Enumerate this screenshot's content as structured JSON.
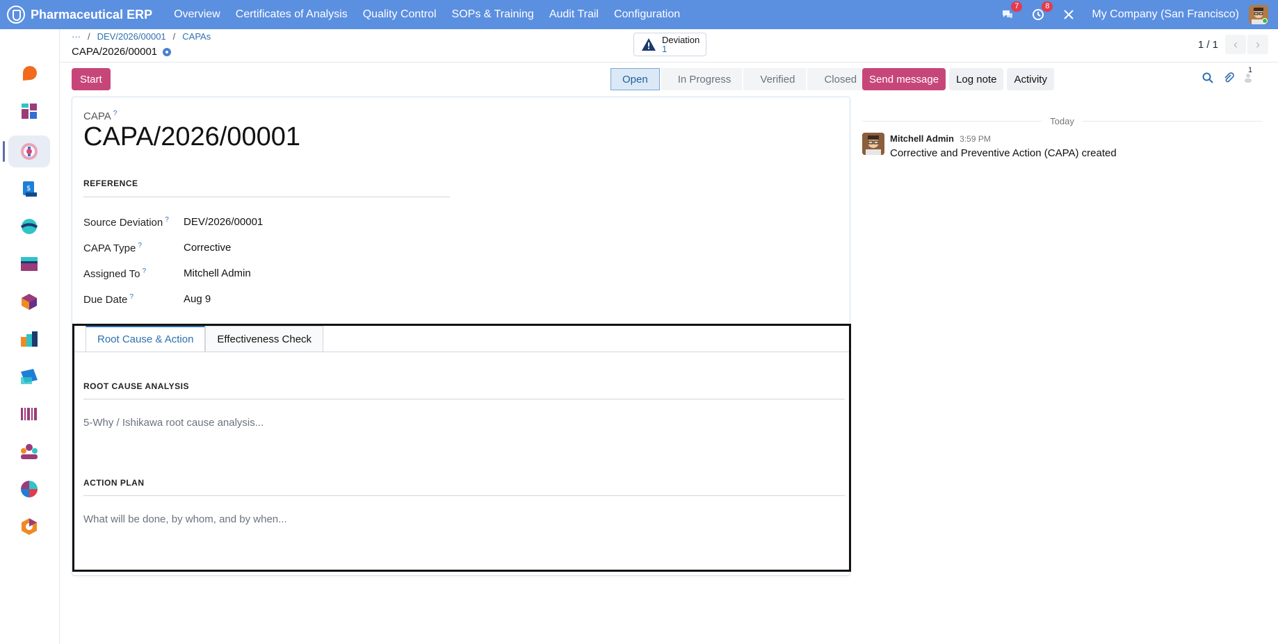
{
  "app": {
    "title": "Pharmaceutical ERP"
  },
  "nav": {
    "items": [
      "Overview",
      "Certificates of Analysis",
      "Quality Control",
      "SOPs & Training",
      "Audit Trail",
      "Configuration"
    ]
  },
  "topbar": {
    "messages_count": "7",
    "activities_count": "8",
    "company": "My Company (San Francisco)"
  },
  "sidebar": {
    "apps": [
      "discuss-icon",
      "dashboard-icon",
      "quality-icon",
      "invoicing-icon",
      "website-icon",
      "accounting-icon",
      "inventory-icon",
      "manufacturing-icon",
      "purchase-icon",
      "barcode-icon",
      "employees-icon",
      "reports-icon",
      "settings-icon"
    ]
  },
  "breadcrumb": {
    "ellipsis": "···",
    "parent": "DEV/2026/00001",
    "list": "CAPAs",
    "current": "CAPA/2026/00001"
  },
  "smart_button": {
    "label": "Deviation",
    "count": "1"
  },
  "pager": {
    "value": "1 / 1",
    "prev": "‹",
    "next": "›"
  },
  "actions": {
    "start": "Start"
  },
  "statusbar": {
    "stages": [
      "Open",
      "In Progress",
      "Verified",
      "Closed"
    ],
    "current": "Open"
  },
  "form": {
    "record_label": "CAPA",
    "record_name": "CAPA/2026/00001",
    "reference_heading": "REFERENCE",
    "fields": [
      {
        "label": "Source Deviation",
        "value": "DEV/2026/00001"
      },
      {
        "label": "CAPA Type",
        "value": "Corrective"
      },
      {
        "label": "Assigned To",
        "value": "Mitchell Admin"
      },
      {
        "label": "Due Date",
        "value": "Aug 9"
      }
    ],
    "help_mark": "?"
  },
  "tabs": {
    "items": [
      "Root Cause & Action",
      "Effectiveness Check"
    ],
    "active": "Root Cause & Action",
    "rca_heading": "ROOT CAUSE ANALYSIS",
    "rca_placeholder": "5-Why / Ishikawa root cause analysis...",
    "action_heading": "ACTION PLAN",
    "action_placeholder": "What will be done, by whom, and by when..."
  },
  "chatter": {
    "send_message": "Send message",
    "log_note": "Log note",
    "activity": "Activity",
    "followers_count": "1",
    "today": "Today",
    "messages": [
      {
        "author": "Mitchell Admin",
        "time": "3:59 PM",
        "body": "Corrective and Preventive Action (CAPA) created"
      }
    ]
  },
  "colors": {
    "navbar": "#5b8fe0",
    "primary_button": "#c7467a",
    "link": "#2e6fb0"
  }
}
